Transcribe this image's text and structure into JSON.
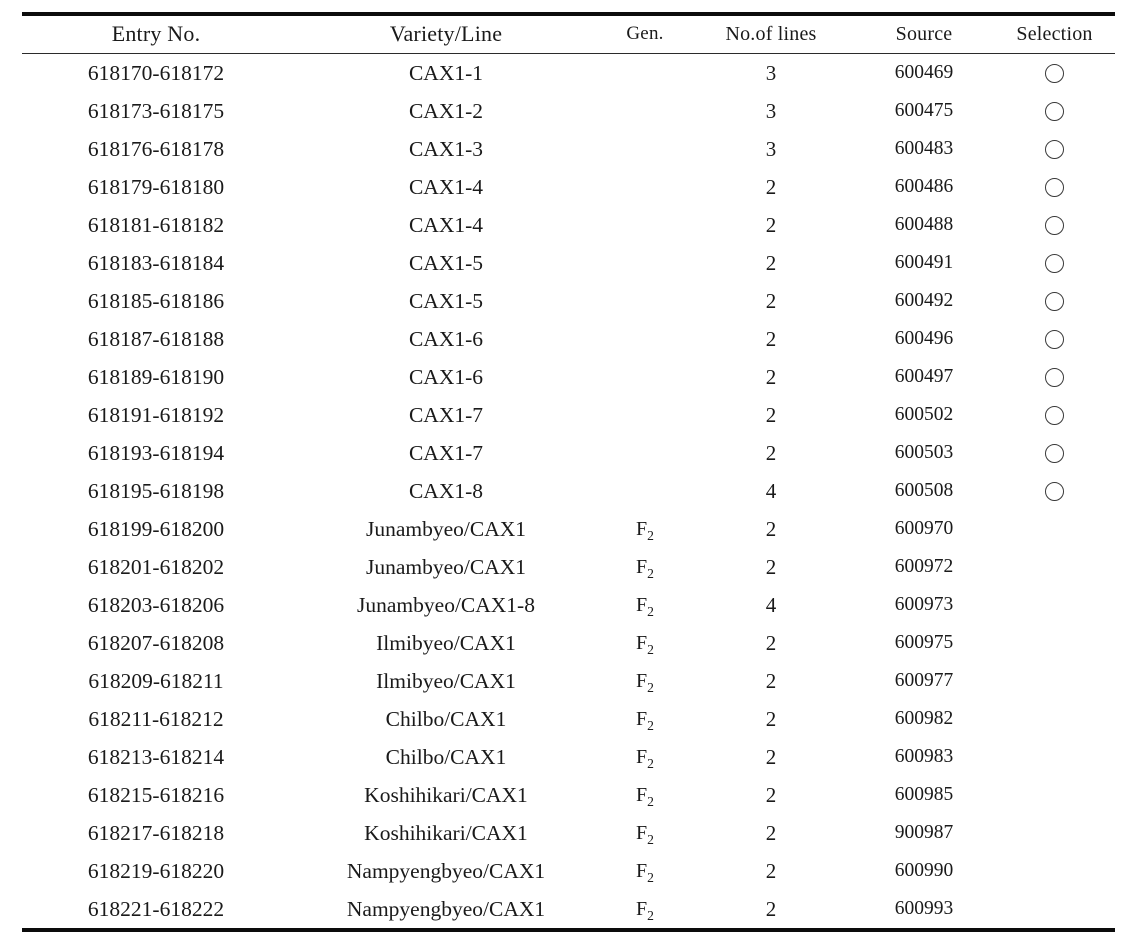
{
  "table": {
    "columns": [
      {
        "key": "entry_no",
        "label": "Entry  No."
      },
      {
        "key": "variety",
        "label": "Variety/Line"
      },
      {
        "key": "gen",
        "label": "Gen."
      },
      {
        "key": "lines",
        "label": "No.of  lines"
      },
      {
        "key": "source",
        "label": "Source"
      },
      {
        "key": "selection",
        "label": "Selection"
      }
    ],
    "selection_mark": "circle-outline",
    "rows": [
      {
        "entry_no": "618170-618172",
        "variety": "CAX1-1",
        "gen_base": "",
        "gen_sub": "",
        "lines": "3",
        "source": "600469",
        "selected": true
      },
      {
        "entry_no": "618173-618175",
        "variety": "CAX1-2",
        "gen_base": "",
        "gen_sub": "",
        "lines": "3",
        "source": "600475",
        "selected": true
      },
      {
        "entry_no": "618176-618178",
        "variety": "CAX1-3",
        "gen_base": "",
        "gen_sub": "",
        "lines": "3",
        "source": "600483",
        "selected": true
      },
      {
        "entry_no": "618179-618180",
        "variety": "CAX1-4",
        "gen_base": "",
        "gen_sub": "",
        "lines": "2",
        "source": "600486",
        "selected": true
      },
      {
        "entry_no": "618181-618182",
        "variety": "CAX1-4",
        "gen_base": "",
        "gen_sub": "",
        "lines": "2",
        "source": "600488",
        "selected": true
      },
      {
        "entry_no": "618183-618184",
        "variety": "CAX1-5",
        "gen_base": "",
        "gen_sub": "",
        "lines": "2",
        "source": "600491",
        "selected": true
      },
      {
        "entry_no": "618185-618186",
        "variety": "CAX1-5",
        "gen_base": "",
        "gen_sub": "",
        "lines": "2",
        "source": "600492",
        "selected": true
      },
      {
        "entry_no": "618187-618188",
        "variety": "CAX1-6",
        "gen_base": "",
        "gen_sub": "",
        "lines": "2",
        "source": "600496",
        "selected": true
      },
      {
        "entry_no": "618189-618190",
        "variety": "CAX1-6",
        "gen_base": "",
        "gen_sub": "",
        "lines": "2",
        "source": "600497",
        "selected": true
      },
      {
        "entry_no": "618191-618192",
        "variety": "CAX1-7",
        "gen_base": "",
        "gen_sub": "",
        "lines": "2",
        "source": "600502",
        "selected": true
      },
      {
        "entry_no": "618193-618194",
        "variety": "CAX1-7",
        "gen_base": "",
        "gen_sub": "",
        "lines": "2",
        "source": "600503",
        "selected": true
      },
      {
        "entry_no": "618195-618198",
        "variety": "CAX1-8",
        "gen_base": "",
        "gen_sub": "",
        "lines": "4",
        "source": "600508",
        "selected": true
      },
      {
        "entry_no": "618199-618200",
        "variety": "Junambyeo/CAX1",
        "gen_base": "F",
        "gen_sub": "2",
        "lines": "2",
        "source": "600970",
        "selected": false
      },
      {
        "entry_no": "618201-618202",
        "variety": "Junambyeo/CAX1",
        "gen_base": "F",
        "gen_sub": "2",
        "lines": "2",
        "source": "600972",
        "selected": false
      },
      {
        "entry_no": "618203-618206",
        "variety": "Junambyeo/CAX1-8",
        "gen_base": "F",
        "gen_sub": "2",
        "lines": "4",
        "source": "600973",
        "selected": false
      },
      {
        "entry_no": "618207-618208",
        "variety": "Ilmibyeo/CAX1",
        "gen_base": "F",
        "gen_sub": "2",
        "lines": "2",
        "source": "600975",
        "selected": false
      },
      {
        "entry_no": "618209-618211",
        "variety": "Ilmibyeo/CAX1",
        "gen_base": "F",
        "gen_sub": "2",
        "lines": "2",
        "source": "600977",
        "selected": false
      },
      {
        "entry_no": "618211-618212",
        "variety": "Chilbo/CAX1",
        "gen_base": "F",
        "gen_sub": "2",
        "lines": "2",
        "source": "600982",
        "selected": false
      },
      {
        "entry_no": "618213-618214",
        "variety": "Chilbo/CAX1",
        "gen_base": "F",
        "gen_sub": "2",
        "lines": "2",
        "source": "600983",
        "selected": false
      },
      {
        "entry_no": "618215-618216",
        "variety": "Koshihikari/CAX1",
        "gen_base": "F",
        "gen_sub": "2",
        "lines": "2",
        "source": "600985",
        "selected": false
      },
      {
        "entry_no": "618217-618218",
        "variety": "Koshihikari/CAX1",
        "gen_base": "F",
        "gen_sub": "2",
        "lines": "2",
        "source": "900987",
        "selected": false
      },
      {
        "entry_no": "618219-618220",
        "variety": "Nampyengbyeo/CAX1",
        "gen_base": "F",
        "gen_sub": "2",
        "lines": "2",
        "source": "600990",
        "selected": false
      },
      {
        "entry_no": "618221-618222",
        "variety": "Nampyengbyeo/CAX1",
        "gen_base": "F",
        "gen_sub": "2",
        "lines": "2",
        "source": "600993",
        "selected": false
      }
    ]
  }
}
